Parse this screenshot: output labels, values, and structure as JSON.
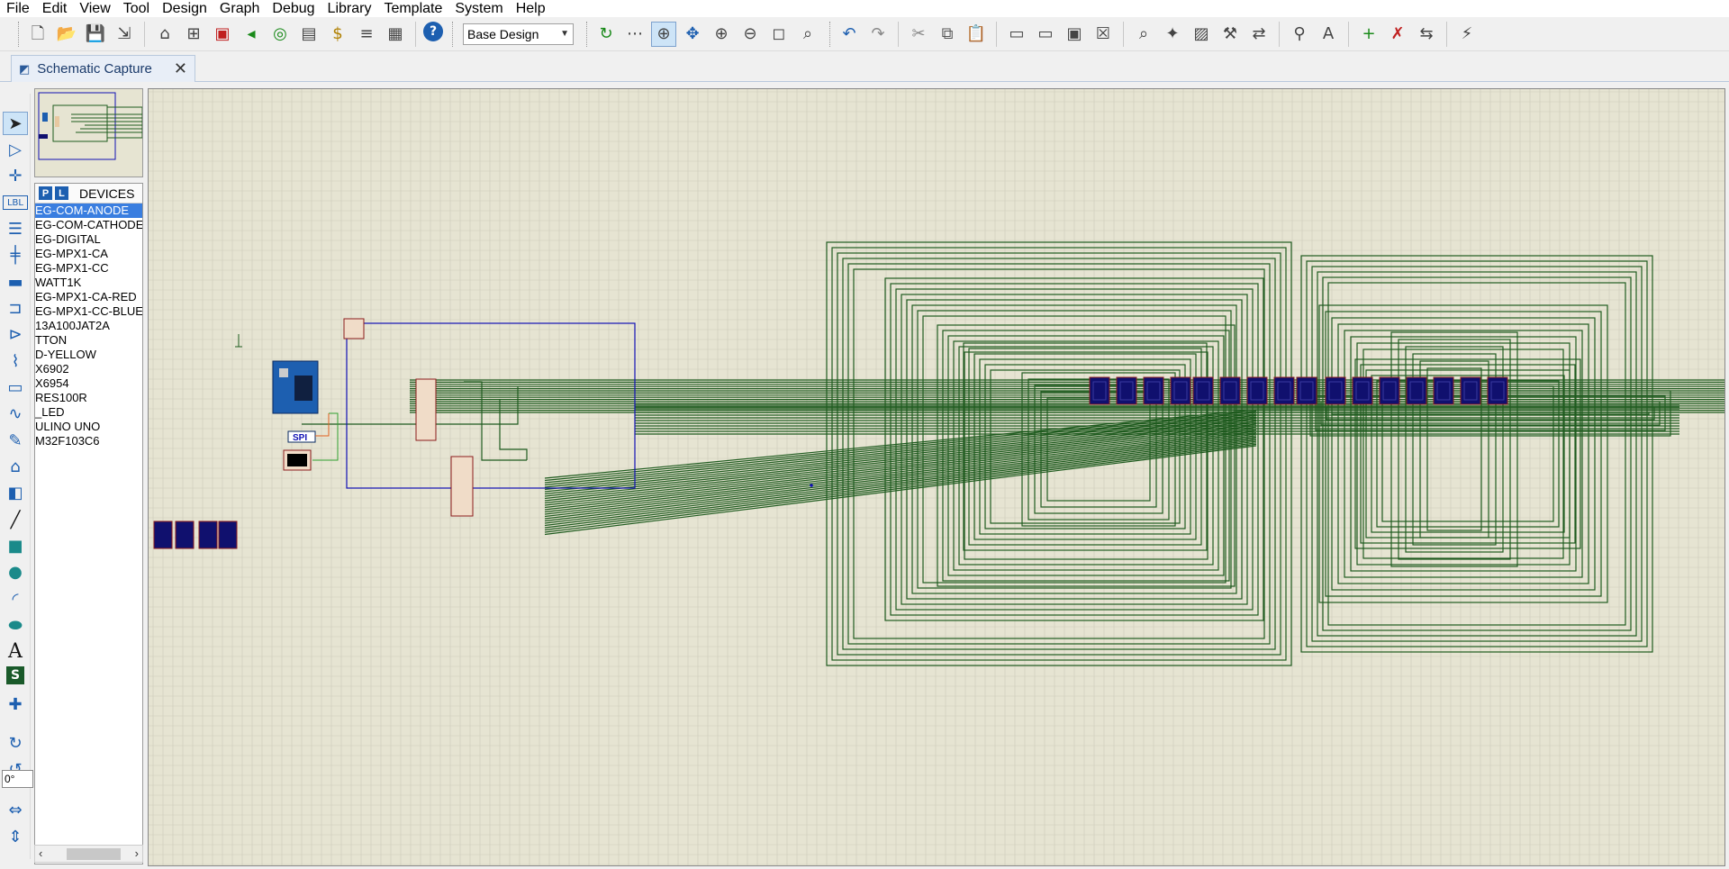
{
  "menu": [
    "File",
    "Edit",
    "View",
    "Tool",
    "Design",
    "Graph",
    "Debug",
    "Library",
    "Template",
    "System",
    "Help"
  ],
  "toolbar": {
    "design_select": "Base Design",
    "icons_a": [
      "new-file-icon",
      "open-folder-icon",
      "save-icon",
      "import-icon",
      "home-icon",
      "schematic-icon",
      "pcb-icon",
      "gerber-icon",
      "3d-viewer-icon",
      "bom-icon",
      "cost-icon",
      "design-explorer-icon",
      "report-icon",
      "help-icon"
    ],
    "icons_b": [
      "refresh-icon",
      "grid-icon",
      "origin-icon",
      "pan-icon",
      "zoom-in-icon",
      "zoom-out-icon",
      "zoom-all-icon",
      "zoom-area-icon"
    ],
    "icons_c": [
      "undo-icon",
      "redo-icon",
      "cut-icon",
      "copy-icon",
      "paste-icon",
      "block-copy-icon",
      "block-move-icon",
      "block-rotate-icon",
      "block-delete-icon",
      "pick-device-icon",
      "make-device-icon",
      "package-tool-icon",
      "decompose-icon",
      "wire-autorouter-icon",
      "search-tag-icon",
      "property-assign-icon",
      "new-sheet-icon",
      "remove-sheet-icon",
      "sheet-nav-icon",
      "electrical-check-icon"
    ]
  },
  "tab": {
    "label": "Schematic Capture"
  },
  "devices_panel": {
    "p_button": "P",
    "l_button": "L",
    "title": "DEVICES",
    "items": [
      "EG-COM-ANODE",
      "EG-COM-CATHODE",
      "EG-DIGITAL",
      "EG-MPX1-CA",
      "EG-MPX1-CC",
      "WATT1K",
      "EG-MPX1-CA-RED",
      "EG-MPX1-CC-BLUE",
      "13A100JAT2A",
      "TTON",
      "D-YELLOW",
      "X6902",
      "X6954",
      "RES100R",
      "_LED",
      "ULINO UNO",
      "M32F103C6"
    ],
    "selected_index": 0
  },
  "left_tools": [
    "selection-mode-icon",
    "component-mode-icon",
    "junction-icon",
    "wire-label-icon",
    "text-script-icon",
    "bus-icon",
    "subcircuit-icon",
    "terminal-icon",
    "device-pin-icon",
    "graph-icon",
    "tape-recorder-icon",
    "generator-icon",
    "voltage-probe-icon",
    "current-probe-icon",
    "virtual-instruments-icon",
    "line-icon",
    "box-icon",
    "circle-icon",
    "arc-icon",
    "path-icon",
    "text-icon",
    "symbol-icon",
    "marker-icon",
    "rotate-cw-icon",
    "rotate-ccw-icon",
    "mirror-x-icon",
    "mirror-y-icon"
  ],
  "rotation_value": "0°",
  "schematic": {
    "spi_label": "SPI",
    "colors": {
      "background": "#e6e4d2",
      "grid": "#cdccba",
      "wire": "#1f5b1f",
      "blue_wire": "#1010b4",
      "component_fill": "#10106e",
      "part_outline": "#8b1c1c",
      "part_fill": "#f0dcc8"
    }
  }
}
